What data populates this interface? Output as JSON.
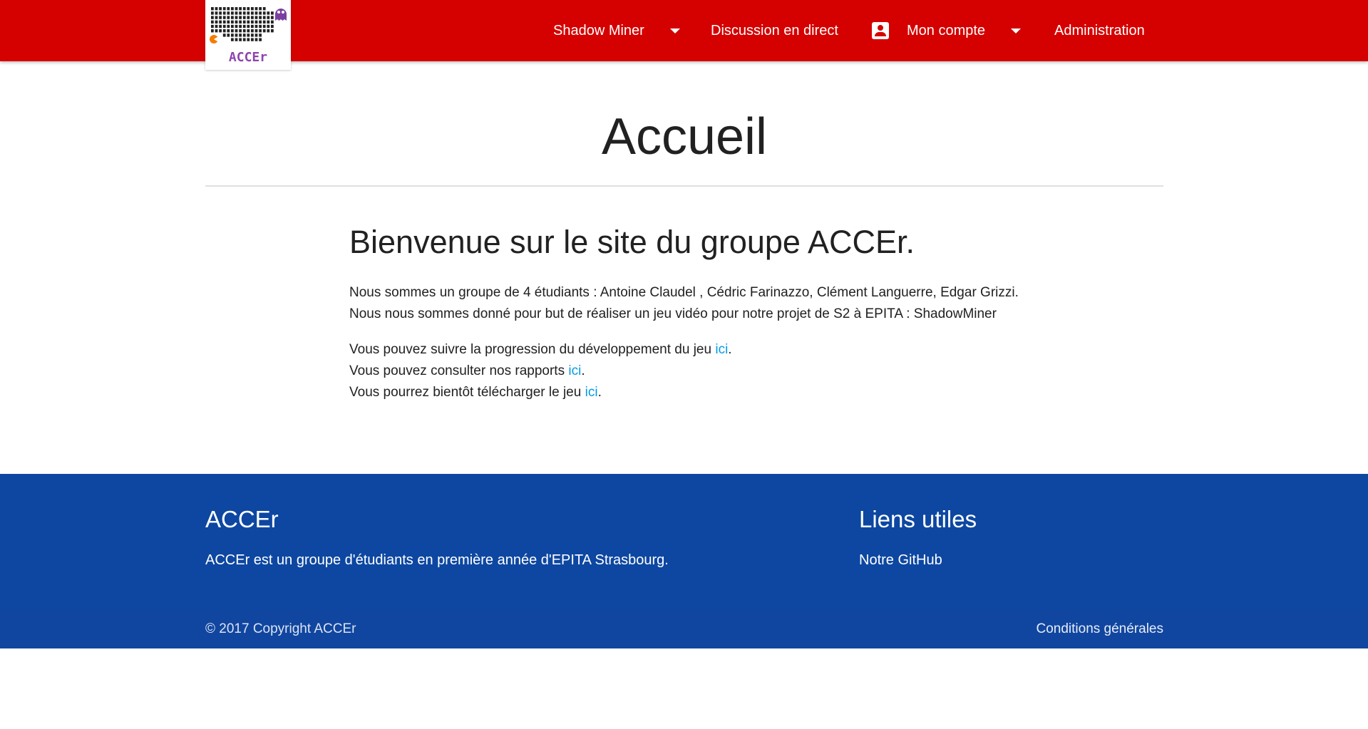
{
  "navbar": {
    "logo_text": "ACCEr",
    "items": [
      {
        "label": "Shadow Miner"
      },
      {
        "label": "Discussion en direct"
      },
      {
        "label": "Mon compte"
      },
      {
        "label": "Administration"
      }
    ],
    "color": "#d50000"
  },
  "main": {
    "title": "Accueil",
    "welcome": "Bienvenue sur le site du groupe ACCEr.",
    "intro_1": "Nous sommes un groupe de 4 étudiants : Antoine Claudel , Cédric Farinazzo, Clément Languerre, Edgar Grizzi.",
    "intro_2": "Nous nous sommes donné pour but de réaliser un jeu vidéo pour notre projet de S2 à EPITA : ShadowMiner",
    "lines": [
      {
        "text": "Vous pouvez suivre la progression du développement du jeu ",
        "link": "ici",
        "end": "."
      },
      {
        "text": "Vous pouvez consulter nos rapports ",
        "link": "ici",
        "end": "."
      },
      {
        "text": "Vous pourrez bientôt télécharger le jeu ",
        "link": "ici",
        "end": "."
      }
    ],
    "link_color": "#039be5"
  },
  "footer": {
    "about_title": "ACCEr",
    "about_text": "ACCEr est un groupe d'étudiants en première année d'EPITA Strasbourg.",
    "links_title": "Liens utiles",
    "github_link": "Notre GitHub",
    "copyright": "© 2017 Copyright ACCEr",
    "terms": "Conditions générales",
    "color": "#0d47a1"
  }
}
